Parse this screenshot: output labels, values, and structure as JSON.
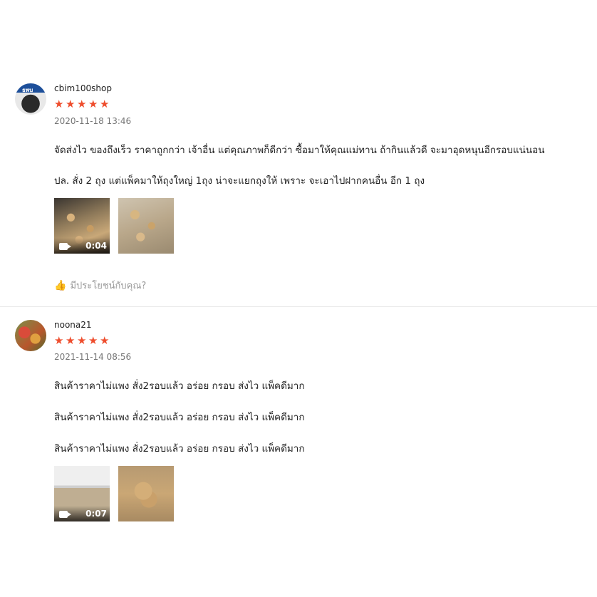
{
  "reviews": [
    {
      "username": "cbim100shop",
      "avatar_text": "ธพบ",
      "rating": 5,
      "stars": [
        "★",
        "★",
        "★",
        "★",
        "★"
      ],
      "date": "2020-11-18 13:46",
      "lines": [
        "จัดส่งไว ของถึงเร็ว ราคาถูกกว่า เจ้าอื่น แต่คุณภาพก็ดีกว่า ซื้อมาให้คุณแม่ทาน ถ้ากินแล้วดี จะมาอุดหนุนอีกรอบแน่นอน",
        "ปล. สั่ง 2 ถุง แต่แพ็คมาให้ถุงใหญ่ 1ถุง น่าจะแยกถุงให้ เพราะ จะเอาไปฝากคนอื่น อีก 1 ถุง"
      ],
      "media": [
        {
          "type": "video",
          "duration": "0:04"
        },
        {
          "type": "image"
        }
      ],
      "helpful_label": "มีประโยชน์กับคุณ?"
    },
    {
      "username": "noona21",
      "rating": 5,
      "stars": [
        "★",
        "★",
        "★",
        "★",
        "★"
      ],
      "date": "2021-11-14 08:56",
      "lines": [
        "สินค้าราคาไม่แพง สั่ง2รอบแล้ว อร่อย กรอบ ส่งไว แพ็คดีมาก",
        "สินค้าราคาไม่แพง สั่ง2รอบแล้ว อร่อย กรอบ ส่งไว แพ็คดีมาก",
        "สินค้าราคาไม่แพง สั่ง2รอบแล้ว อร่อย กรอบ ส่งไว แพ็คดีมาก"
      ],
      "media": [
        {
          "type": "video",
          "duration": "0:07"
        },
        {
          "type": "image"
        }
      ]
    }
  ],
  "colors": {
    "star": "#ee4d2d",
    "muted": "#757575",
    "divider": "#e8e8e8"
  },
  "icons": {
    "star": "star-icon",
    "helpful": "thumbs-up-icon",
    "video": "video-camera-icon"
  }
}
